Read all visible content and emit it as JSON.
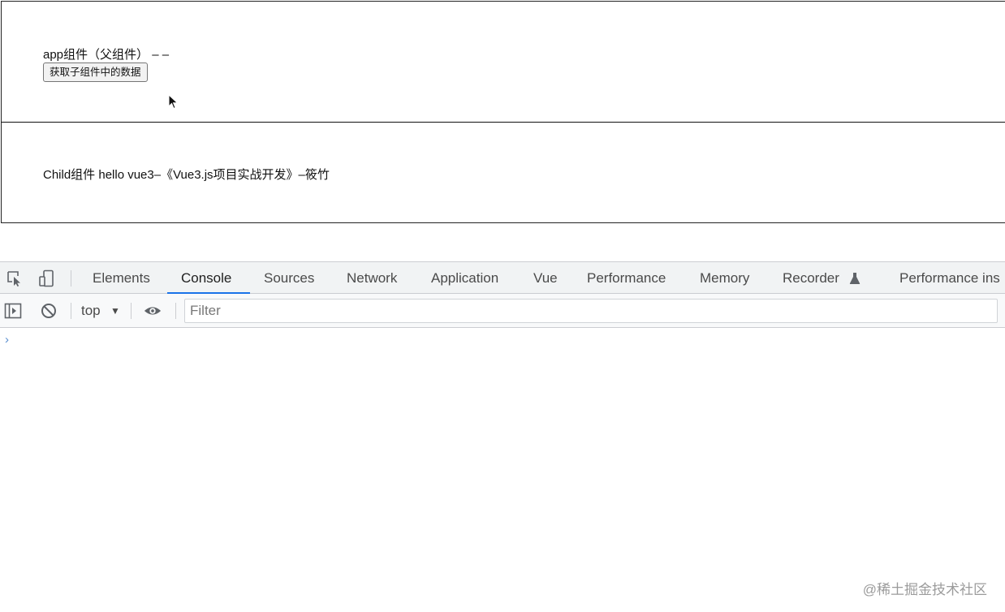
{
  "page": {
    "app_text": "app组件（父组件） – –",
    "button_label": "获取子组件中的数据",
    "child_text": "Child组件 hello vue3–《Vue3.js项目实战开发》–筱竹"
  },
  "devtools": {
    "tabs": [
      "Elements",
      "Console",
      "Sources",
      "Network",
      "Application",
      "Vue",
      "Performance",
      "Memory",
      "Recorder",
      "Performance ins"
    ],
    "active_tab": "Console",
    "context": "top",
    "filter_placeholder": "Filter",
    "prompt_symbol": "›",
    "accent_color": "#1a73e8"
  },
  "watermark": "@稀土掘金技术社区"
}
